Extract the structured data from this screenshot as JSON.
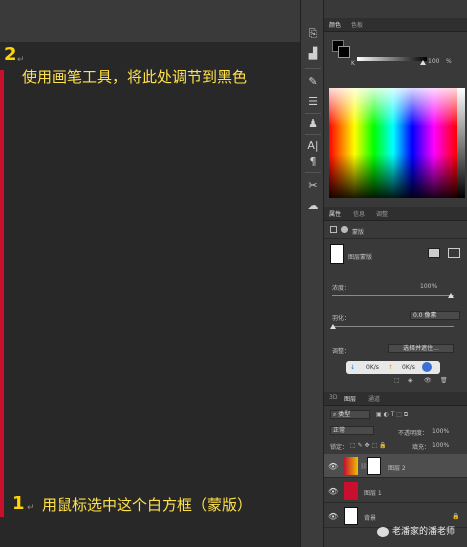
{
  "instructions": {
    "step2": {
      "number": "2",
      "text": "使用画笔工具，将此处调节到黑色"
    },
    "step1": {
      "number": "1",
      "text": "用鼠标选中这个白方框（蒙版）"
    }
  },
  "color_panel": {
    "tab_color": "颜色",
    "tab_swatches": "色板",
    "k_label": "K",
    "k_value": "100",
    "percent": "%"
  },
  "properties_panel": {
    "tab_properties": "属性",
    "tab_info": "信息",
    "tab_adjust": "调整",
    "mask_type": "蒙版",
    "layer_mask_label": "图层蒙版",
    "density_label": "浓度：",
    "density_value": "100%",
    "feather_label": "羽化：",
    "feather_value": "0.0 像素",
    "adjust_label": "调整：",
    "select_mask_button": "选择并遮住...",
    "status_left": "0K/s",
    "status_right": "0K/s"
  },
  "layers_panel": {
    "tab_3d": "3D",
    "tab_layers": "图层",
    "tab_channels": "通道",
    "filter_kind": "类型",
    "blend_mode": "正常",
    "opacity_label": "不透明度：",
    "opacity_value": "100%",
    "lock_label": "锁定：",
    "fill_label": "填充：",
    "fill_value": "100%",
    "layers": [
      {
        "name": "图层 2"
      },
      {
        "name": "图层 1"
      },
      {
        "name": "背景"
      }
    ]
  },
  "watermark": {
    "text": "老潘家的潘老师"
  },
  "colors": {
    "accent_red": "#c8102e",
    "annotation_yellow": "#ffe24a"
  }
}
